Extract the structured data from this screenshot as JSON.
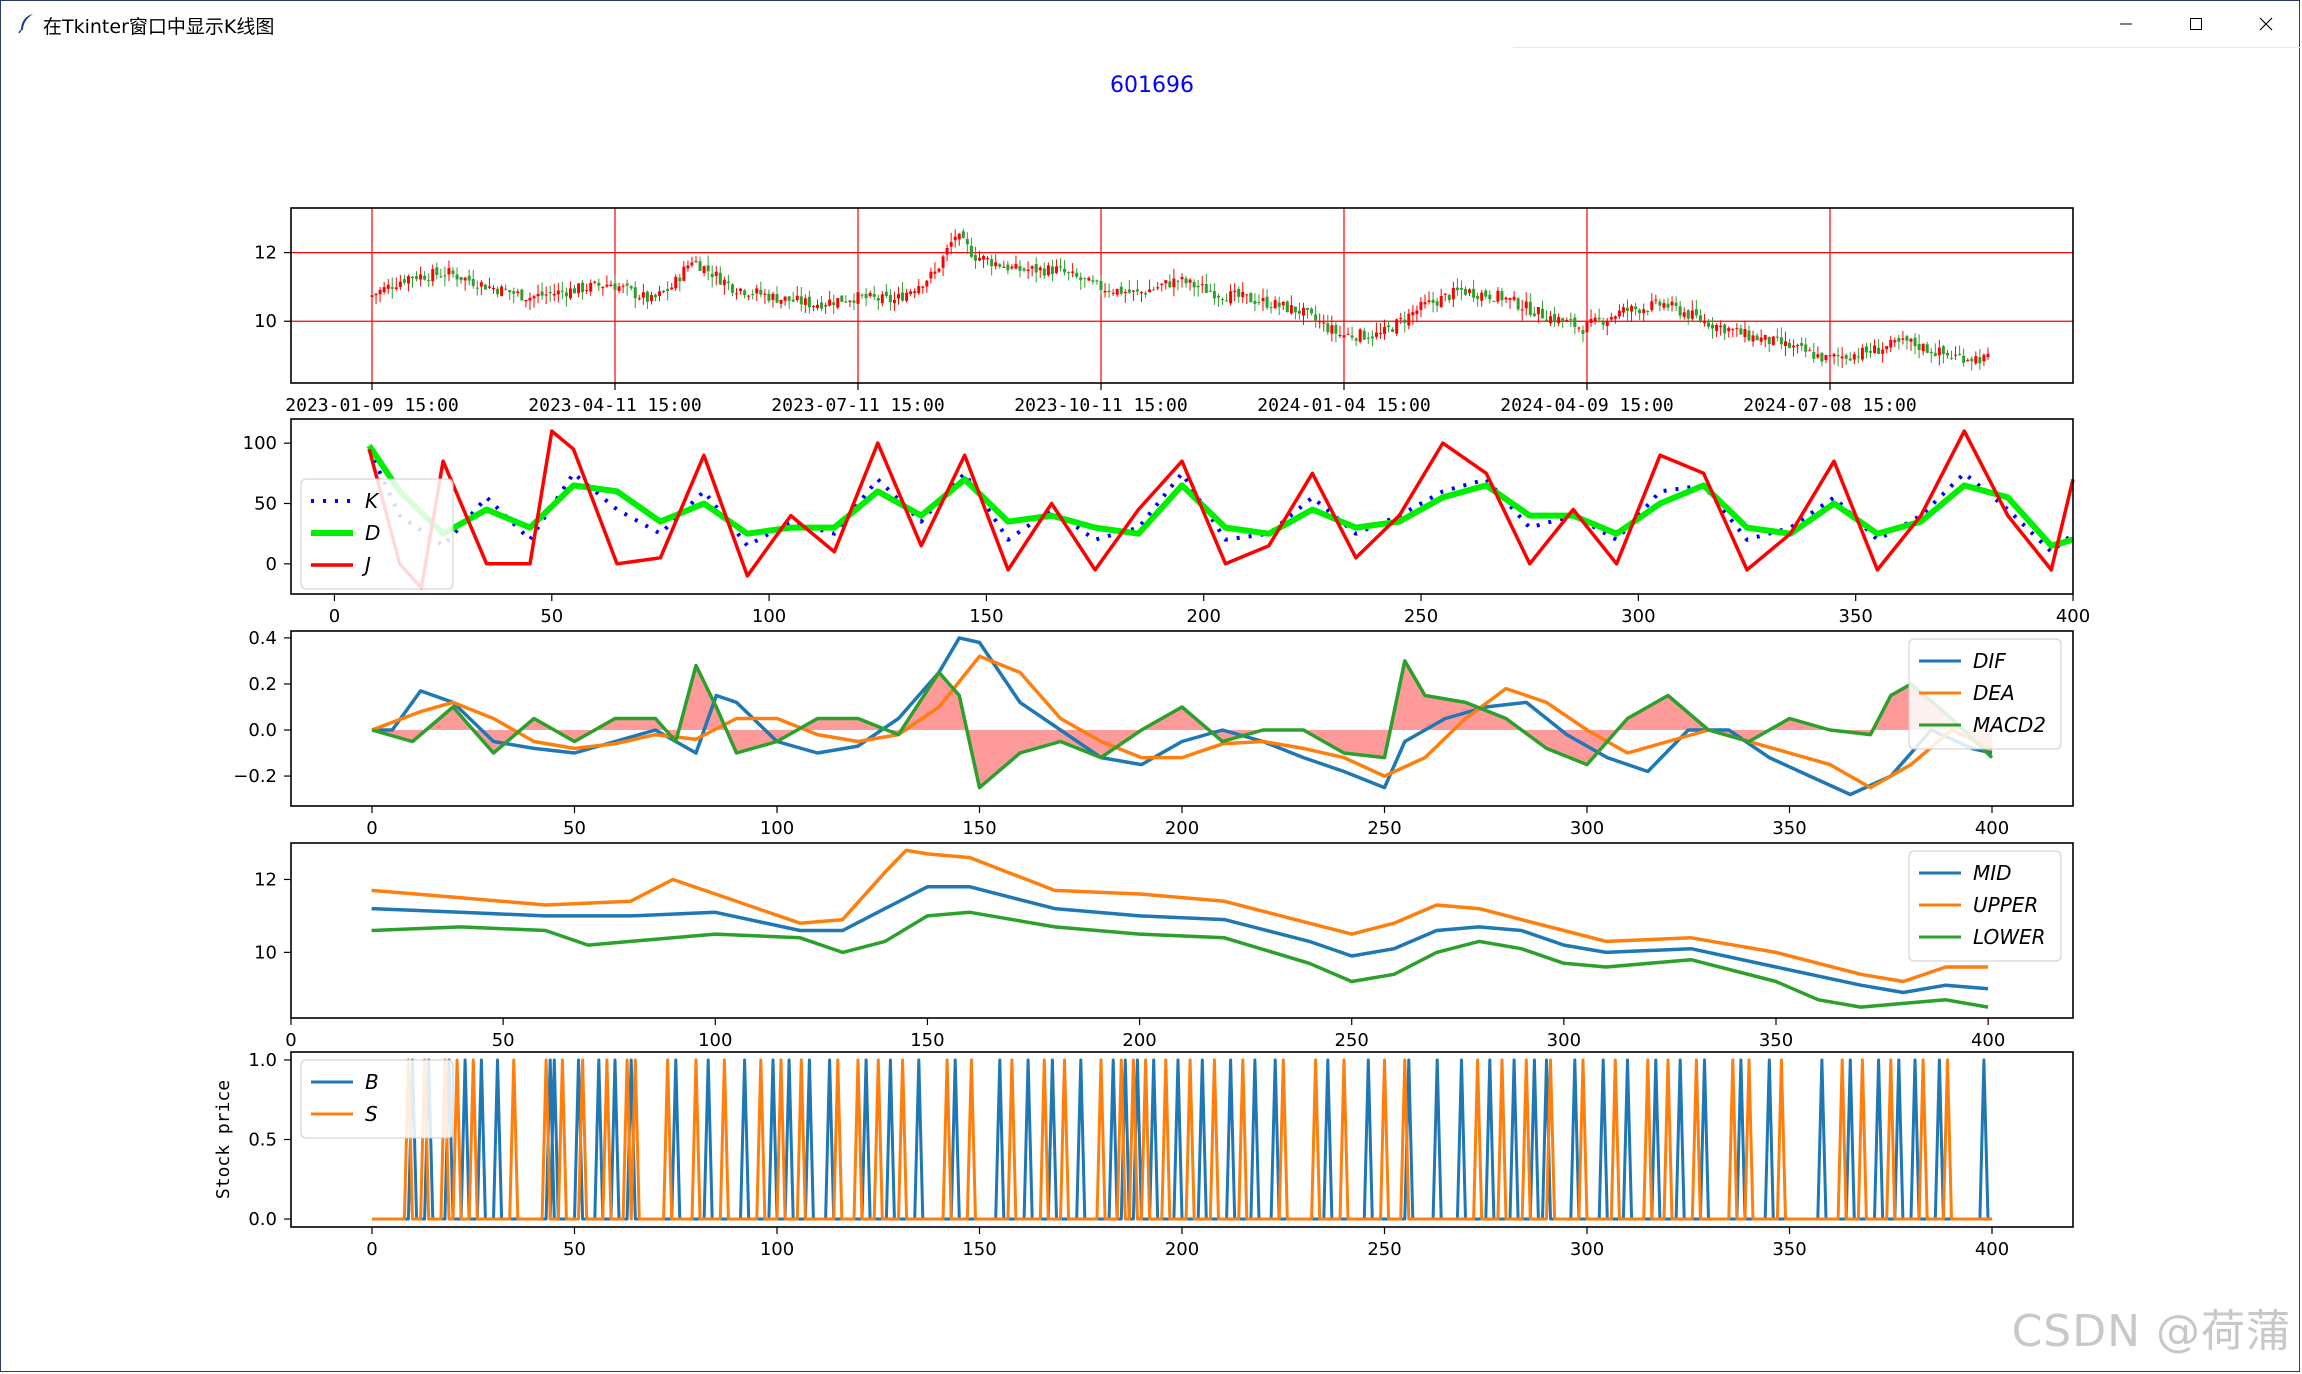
{
  "window": {
    "title": "在Tkinter窗口中显示K线图",
    "icon": "feather-icon",
    "controls": [
      "minimize-icon",
      "maximize-icon",
      "close-icon"
    ]
  },
  "figure_title": "601696",
  "watermark": "CSDN @荷蒲",
  "colors": {
    "title": "#0000ff",
    "up": "#ff0000",
    "down": "#2ca02c",
    "grid": "#ff0000",
    "k": "#0000ff",
    "d": "#00ee00",
    "j": "#ff0000",
    "dif": "#1f77b4",
    "dea": "#ff7f0e",
    "macd": "#2ca02c",
    "macd_fill": "#ff9a9a",
    "mid": "#1f77b4",
    "upper": "#ff7f0e",
    "lower": "#2ca02c",
    "b": "#1f77b4",
    "s": "#ff7f0e"
  },
  "chart_data": [
    {
      "type": "candlestick",
      "title": "601696",
      "xtick_labels": [
        "2023-01-09  15:00",
        "2023-04-11  15:00",
        "2023-07-11  15:00",
        "2023-10-11  15:00",
        "2024-01-04  15:00",
        "2024-04-09  15:00",
        "2024-07-08  15:00"
      ],
      "yticks": [
        10,
        12
      ],
      "ylim": [
        8.2,
        13.3
      ],
      "grid": true,
      "close_series": {
        "x": [
          0,
          10,
          20,
          30,
          40,
          50,
          60,
          70,
          75,
          80,
          90,
          100,
          110,
          120,
          130,
          140,
          145,
          150,
          160,
          170,
          180,
          190,
          200,
          210,
          220,
          230,
          240,
          250,
          255,
          260,
          270,
          280,
          290,
          300,
          310,
          320,
          330,
          340,
          350,
          360,
          370,
          380,
          390,
          400
        ],
        "y": [
          10.7,
          11.3,
          11.4,
          11.0,
          10.7,
          10.9,
          11.1,
          10.6,
          11.0,
          11.8,
          11.0,
          10.7,
          10.5,
          10.7,
          10.6,
          11.4,
          12.5,
          11.9,
          11.5,
          11.5,
          11.0,
          10.8,
          11.2,
          10.8,
          10.6,
          10.3,
          9.6,
          9.6,
          10.0,
          10.4,
          10.9,
          10.7,
          10.2,
          9.8,
          10.3,
          10.5,
          10.0,
          9.6,
          9.3,
          8.9,
          9.1,
          9.4,
          9.0,
          8.9
        ]
      }
    },
    {
      "type": "line",
      "series_names": [
        "K",
        "D",
        "J"
      ],
      "xlim": [
        -10,
        400
      ],
      "ylim": [
        -25,
        120
      ],
      "xticks": [
        0,
        50,
        100,
        150,
        200,
        250,
        300,
        350,
        400
      ],
      "yticks": [
        0,
        50,
        100
      ],
      "legend": "left",
      "series": [
        {
          "name": "K",
          "style": "dotted",
          "x": [
            8,
            15,
            25,
            35,
            45,
            55,
            65,
            75,
            85,
            95,
            105,
            115,
            125,
            135,
            145,
            155,
            165,
            175,
            185,
            195,
            205,
            215,
            225,
            235,
            245,
            255,
            265,
            275,
            285,
            295,
            305,
            315,
            325,
            335,
            345,
            355,
            365,
            375,
            385,
            395,
            400
          ],
          "y": [
            95,
            40,
            15,
            55,
            20,
            75,
            45,
            25,
            60,
            15,
            35,
            25,
            70,
            35,
            75,
            20,
            45,
            20,
            30,
            75,
            20,
            25,
            55,
            25,
            40,
            60,
            70,
            30,
            40,
            20,
            60,
            65,
            20,
            30,
            55,
            20,
            40,
            75,
            45,
            10,
            25
          ]
        },
        {
          "name": "D",
          "style": "solid-thick",
          "x": [
            8,
            15,
            25,
            35,
            45,
            55,
            65,
            75,
            85,
            95,
            105,
            115,
            125,
            135,
            145,
            155,
            165,
            175,
            185,
            195,
            205,
            215,
            225,
            235,
            245,
            255,
            265,
            275,
            285,
            295,
            305,
            315,
            325,
            335,
            345,
            355,
            365,
            375,
            385,
            395,
            400
          ],
          "y": [
            98,
            60,
            25,
            45,
            30,
            65,
            60,
            35,
            50,
            25,
            30,
            30,
            60,
            40,
            70,
            35,
            40,
            30,
            25,
            65,
            30,
            25,
            45,
            30,
            35,
            55,
            65,
            40,
            40,
            25,
            50,
            65,
            30,
            25,
            50,
            25,
            35,
            65,
            55,
            15,
            20
          ]
        },
        {
          "name": "J",
          "style": "solid",
          "x": [
            8,
            15,
            20,
            25,
            35,
            45,
            50,
            55,
            65,
            75,
            85,
            95,
            105,
            115,
            125,
            135,
            145,
            155,
            165,
            175,
            185,
            195,
            205,
            215,
            225,
            235,
            245,
            255,
            265,
            275,
            285,
            295,
            305,
            315,
            325,
            335,
            345,
            355,
            365,
            375,
            385,
            395,
            400
          ],
          "y": [
            95,
            0,
            -20,
            85,
            0,
            0,
            110,
            95,
            0,
            5,
            90,
            -10,
            40,
            10,
            100,
            15,
            90,
            -5,
            50,
            -5,
            45,
            85,
            0,
            15,
            75,
            5,
            40,
            100,
            75,
            0,
            45,
            0,
            90,
            75,
            -5,
            25,
            85,
            -5,
            40,
            110,
            40,
            -5,
            70
          ]
        }
      ]
    },
    {
      "type": "line",
      "series_names": [
        "DIF",
        "DEA",
        "MACD2"
      ],
      "xlim": [
        -20,
        420
      ],
      "ylim": [
        -0.33,
        0.43
      ],
      "xticks": [
        0,
        50,
        100,
        150,
        200,
        250,
        300,
        350,
        400
      ],
      "yticks": [
        -0.2,
        0.0,
        0.2,
        0.4
      ],
      "legend": "top-right",
      "series": [
        {
          "name": "DIF",
          "x": [
            0,
            5,
            12,
            20,
            30,
            40,
            50,
            60,
            70,
            80,
            85,
            90,
            100,
            110,
            120,
            130,
            140,
            145,
            150,
            160,
            170,
            180,
            190,
            200,
            210,
            220,
            230,
            240,
            250,
            255,
            265,
            275,
            285,
            295,
            305,
            315,
            325,
            335,
            345,
            355,
            365,
            375,
            385,
            395,
            400
          ],
          "y": [
            0.0,
            0.0,
            0.17,
            0.12,
            -0.05,
            -0.08,
            -0.1,
            -0.05,
            0.0,
            -0.1,
            0.15,
            0.12,
            -0.05,
            -0.1,
            -0.07,
            0.05,
            0.25,
            0.4,
            0.38,
            0.12,
            0.0,
            -0.12,
            -0.15,
            -0.05,
            0.0,
            -0.05,
            -0.12,
            -0.18,
            -0.25,
            -0.05,
            0.05,
            0.1,
            0.12,
            -0.02,
            -0.12,
            -0.18,
            0.0,
            0.0,
            -0.12,
            -0.2,
            -0.28,
            -0.2,
            0.0,
            -0.08,
            -0.1
          ]
        },
        {
          "name": "DEA",
          "x": [
            0,
            12,
            20,
            30,
            40,
            50,
            60,
            70,
            80,
            90,
            100,
            110,
            120,
            130,
            140,
            150,
            160,
            170,
            180,
            190,
            200,
            210,
            220,
            230,
            240,
            250,
            260,
            270,
            280,
            290,
            300,
            310,
            320,
            330,
            340,
            350,
            360,
            370,
            380,
            390,
            400
          ],
          "y": [
            0.0,
            0.08,
            0.12,
            0.05,
            -0.05,
            -0.08,
            -0.06,
            -0.02,
            -0.04,
            0.05,
            0.05,
            -0.02,
            -0.05,
            -0.02,
            0.1,
            0.32,
            0.25,
            0.05,
            -0.05,
            -0.12,
            -0.12,
            -0.06,
            -0.05,
            -0.08,
            -0.12,
            -0.2,
            -0.12,
            0.05,
            0.18,
            0.12,
            0.0,
            -0.1,
            -0.05,
            0.0,
            -0.05,
            -0.1,
            -0.15,
            -0.25,
            -0.15,
            0.0,
            -0.08
          ]
        },
        {
          "name": "MACD2",
          "x": [
            0,
            10,
            20,
            30,
            40,
            50,
            60,
            70,
            75,
            80,
            85,
            90,
            100,
            110,
            120,
            130,
            140,
            145,
            150,
            160,
            170,
            180,
            190,
            200,
            210,
            220,
            230,
            240,
            250,
            255,
            260,
            270,
            280,
            290,
            300,
            310,
            320,
            330,
            340,
            350,
            360,
            370,
            375,
            380,
            390,
            400
          ],
          "y": [
            0.0,
            -0.05,
            0.1,
            -0.1,
            0.05,
            -0.05,
            0.05,
            0.05,
            -0.05,
            0.28,
            0.1,
            -0.1,
            -0.05,
            0.05,
            0.05,
            -0.02,
            0.25,
            0.15,
            -0.25,
            -0.1,
            -0.05,
            -0.12,
            0.0,
            0.1,
            -0.05,
            0.0,
            0.0,
            -0.1,
            -0.12,
            0.3,
            0.15,
            0.12,
            0.05,
            -0.08,
            -0.15,
            0.05,
            0.15,
            0.0,
            -0.05,
            0.05,
            0.0,
            -0.02,
            0.15,
            0.2,
            0.05,
            -0.12
          ]
        }
      ]
    },
    {
      "type": "line",
      "series_names": [
        "MID",
        "UPPER",
        "LOWER"
      ],
      "xlim": [
        0,
        420
      ],
      "ylim": [
        8.2,
        13.0
      ],
      "xticks": [
        0,
        50,
        100,
        150,
        200,
        250,
        300,
        350,
        400
      ],
      "yticks": [
        10,
        12
      ],
      "legend": "top-right",
      "series": [
        {
          "name": "MID",
          "x": [
            19,
            40,
            60,
            80,
            100,
            120,
            130,
            140,
            150,
            160,
            180,
            200,
            220,
            240,
            250,
            260,
            270,
            280,
            290,
            300,
            310,
            330,
            350,
            370,
            380,
            390,
            400
          ],
          "y": [
            11.2,
            11.1,
            11.0,
            11.0,
            11.1,
            10.6,
            10.6,
            11.2,
            11.8,
            11.8,
            11.2,
            11.0,
            10.9,
            10.3,
            9.9,
            10.1,
            10.6,
            10.7,
            10.6,
            10.2,
            10.0,
            10.1,
            9.6,
            9.1,
            8.9,
            9.1,
            9.0
          ]
        },
        {
          "name": "UPPER",
          "x": [
            19,
            40,
            60,
            80,
            90,
            100,
            120,
            130,
            140,
            145,
            150,
            160,
            180,
            200,
            220,
            240,
            250,
            260,
            270,
            280,
            290,
            300,
            310,
            330,
            350,
            370,
            380,
            390,
            400
          ],
          "y": [
            11.7,
            11.5,
            11.3,
            11.4,
            12.0,
            11.6,
            10.8,
            10.9,
            12.2,
            12.8,
            12.7,
            12.6,
            11.7,
            11.6,
            11.4,
            10.8,
            10.5,
            10.8,
            11.3,
            11.2,
            10.9,
            10.6,
            10.3,
            10.4,
            10.0,
            9.4,
            9.2,
            9.6,
            9.6
          ]
        },
        {
          "name": "LOWER",
          "x": [
            19,
            40,
            60,
            70,
            80,
            100,
            120,
            130,
            140,
            150,
            160,
            180,
            200,
            220,
            240,
            250,
            260,
            270,
            280,
            290,
            300,
            310,
            330,
            350,
            360,
            370,
            380,
            390,
            400
          ],
          "y": [
            10.6,
            10.7,
            10.6,
            10.2,
            10.3,
            10.5,
            10.4,
            10.0,
            10.3,
            11.0,
            11.1,
            10.7,
            10.5,
            10.4,
            9.7,
            9.2,
            9.4,
            10.0,
            10.3,
            10.1,
            9.7,
            9.6,
            9.8,
            9.2,
            8.7,
            8.5,
            8.6,
            8.7,
            8.5
          ]
        }
      ]
    },
    {
      "type": "line",
      "series_names": [
        "B",
        "S"
      ],
      "ylabel": "Stock price",
      "xlim": [
        -20,
        420
      ],
      "ylim": [
        -0.05,
        1.05
      ],
      "xticks": [
        0,
        50,
        100,
        150,
        200,
        250,
        300,
        350,
        400
      ],
      "yticks": [
        0.0,
        0.5,
        1.0
      ],
      "yticklabels": [
        "0.0",
        "0.5",
        "1.0"
      ],
      "legend": "top-left",
      "series": [
        {
          "name": "B",
          "signal_x": [
            10,
            14,
            19,
            23,
            27,
            31,
            44,
            45,
            51,
            56,
            60,
            64,
            75,
            83,
            92,
            99,
            103,
            108,
            113,
            122,
            128,
            135,
            144,
            155,
            162,
            168,
            175,
            183,
            186,
            189,
            193,
            199,
            205,
            212,
            218,
            223,
            236,
            246,
            256,
            263,
            269,
            276,
            282,
            287,
            290,
            297,
            304,
            310,
            317,
            323,
            329,
            338,
            345,
            358,
            365,
            372,
            377,
            381,
            387,
            398
          ]
        },
        {
          "name": "S",
          "signal_x": [
            9,
            13,
            18,
            21,
            25,
            35,
            43,
            47,
            52,
            58,
            63,
            65,
            73,
            80,
            87,
            96,
            101,
            106,
            115,
            120,
            125,
            131,
            142,
            148,
            158,
            166,
            171,
            180,
            185,
            188,
            191,
            196,
            202,
            208,
            215,
            225,
            233,
            240,
            250,
            255,
            273,
            279,
            285,
            291,
            299,
            307,
            315,
            320,
            327,
            336,
            340,
            348,
            363,
            368,
            375,
            383,
            389
          ]
        }
      ]
    }
  ]
}
